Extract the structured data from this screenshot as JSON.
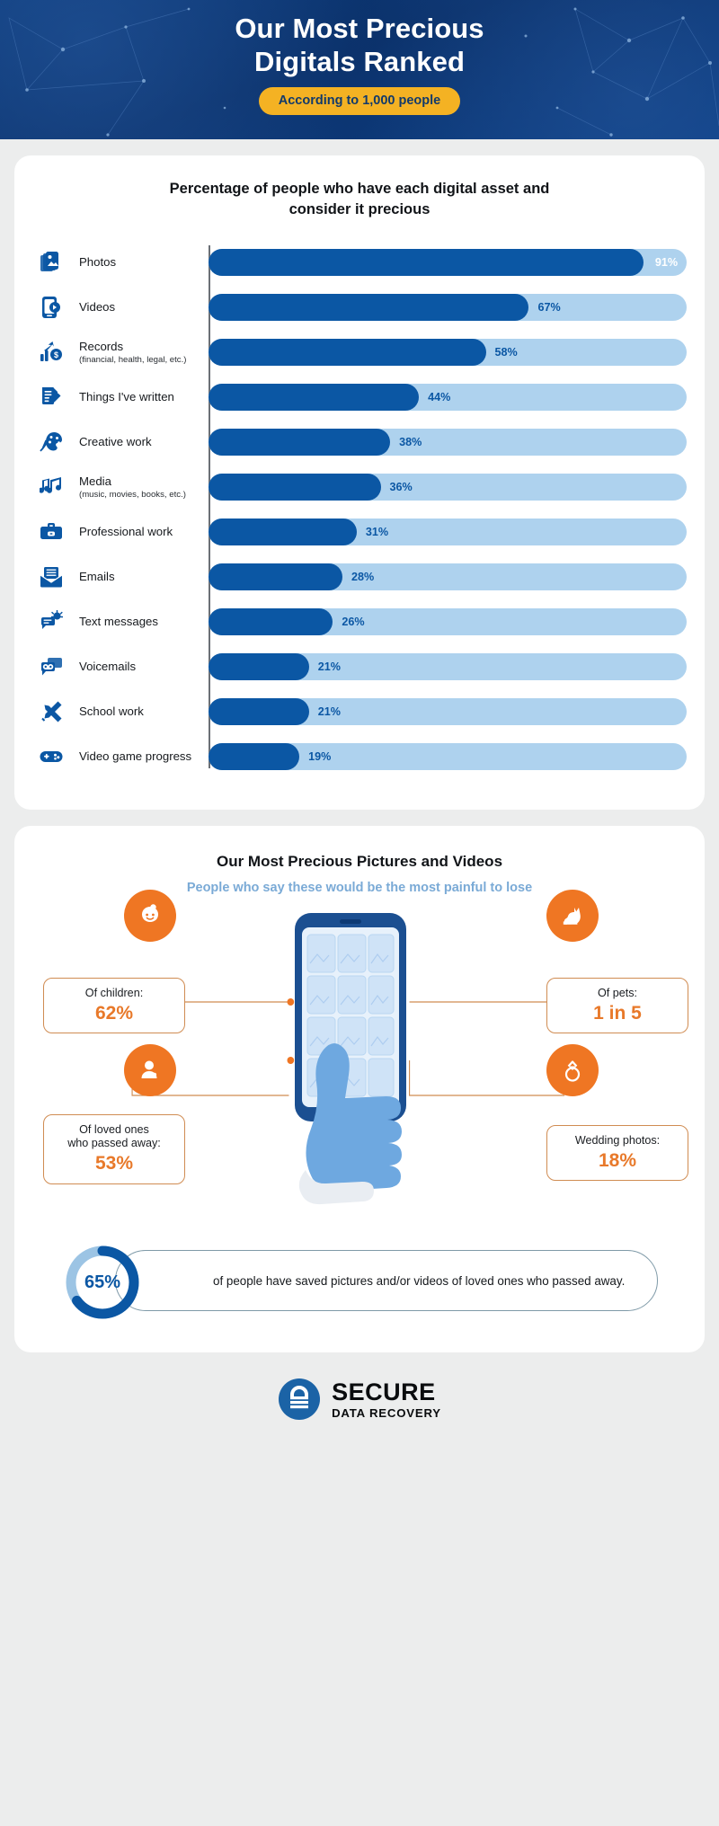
{
  "header": {
    "title_line1": "Our Most Precious",
    "title_line2": "Digitals Ranked",
    "badge": "According to 1,000 people",
    "bg_color": "#0a3069",
    "badge_color": "#f4b223"
  },
  "section1": {
    "title": "Percentage of people who have each digital asset and consider it precious"
  },
  "chart_data": {
    "type": "bar",
    "orientation": "horizontal",
    "title": "Percentage of people who have each digital asset and consider it precious",
    "xlabel": "",
    "ylabel": "",
    "xlim": [
      0,
      100
    ],
    "unit": "%",
    "grid": false,
    "legend": "none",
    "bar_color": "#0b57a4",
    "track_color": "#aed2ee",
    "categories": [
      "Photos",
      "Videos",
      "Records",
      "Things I've written",
      "Creative work",
      "Media",
      "Professional work",
      "Emails",
      "Text messages",
      "Voicemails",
      "School work",
      "Video game progress"
    ],
    "values": [
      91,
      67,
      58,
      44,
      38,
      36,
      31,
      28,
      26,
      21,
      21,
      19
    ],
    "rows": [
      {
        "label": "Photos",
        "sub": "",
        "value": 91,
        "display": "91%",
        "icon": "photos-icon",
        "label_inside": true
      },
      {
        "label": "Videos",
        "sub": "",
        "value": 67,
        "display": "67%",
        "icon": "videos-icon",
        "label_inside": false
      },
      {
        "label": "Records",
        "sub": "(financial, health, legal, etc.)",
        "value": 58,
        "display": "58%",
        "icon": "records-icon",
        "label_inside": false
      },
      {
        "label": "Things I've written",
        "sub": "",
        "value": 44,
        "display": "44%",
        "icon": "writing-icon",
        "label_inside": false
      },
      {
        "label": "Creative work",
        "sub": "",
        "value": 38,
        "display": "38%",
        "icon": "creative-work-icon",
        "label_inside": false
      },
      {
        "label": "Media",
        "sub": "(music, movies, books, etc.)",
        "value": 36,
        "display": "36%",
        "icon": "media-icon",
        "label_inside": false
      },
      {
        "label": "Professional work",
        "sub": "",
        "value": 31,
        "display": "31%",
        "icon": "briefcase-icon",
        "label_inside": false
      },
      {
        "label": "Emails",
        "sub": "",
        "value": 28,
        "display": "28%",
        "icon": "email-icon",
        "label_inside": false
      },
      {
        "label": "Text messages",
        "sub": "",
        "value": 26,
        "display": "26%",
        "icon": "text-message-icon",
        "label_inside": false
      },
      {
        "label": "Voicemails",
        "sub": "",
        "value": 21,
        "display": "21%",
        "icon": "voicemail-icon",
        "label_inside": false
      },
      {
        "label": "School work",
        "sub": "",
        "value": 21,
        "display": "21%",
        "icon": "school-work-icon",
        "label_inside": false
      },
      {
        "label": "Video game progress",
        "sub": "",
        "value": 19,
        "display": "19%",
        "icon": "video-game-icon",
        "label_inside": false
      }
    ]
  },
  "section2": {
    "title": "Our Most Precious Pictures and Videos",
    "subtitle": "People who say these would be the most painful to lose",
    "accent_color": "#ef7623",
    "callouts": [
      {
        "id": "children",
        "label": "Of children:",
        "value": "62%",
        "icon": "baby-icon"
      },
      {
        "id": "pets",
        "label": "Of pets:",
        "value": "1 in 5",
        "icon": "cat-icon"
      },
      {
        "id": "loved",
        "label": "Of loved ones\nwho passed away:",
        "value": "53%",
        "icon": "person-heart-icon"
      },
      {
        "id": "wedding",
        "label": "Wedding photos:",
        "value": "18%",
        "icon": "ring-icon"
      }
    ],
    "stat": {
      "percent": "65%",
      "percent_value": 65,
      "text": "of people have saved pictures and/or videos of loved ones who passed away."
    }
  },
  "footer": {
    "logo_main": "SECURE",
    "logo_sub": "DATA RECOVERY",
    "logo_color": "#1b63a6"
  }
}
